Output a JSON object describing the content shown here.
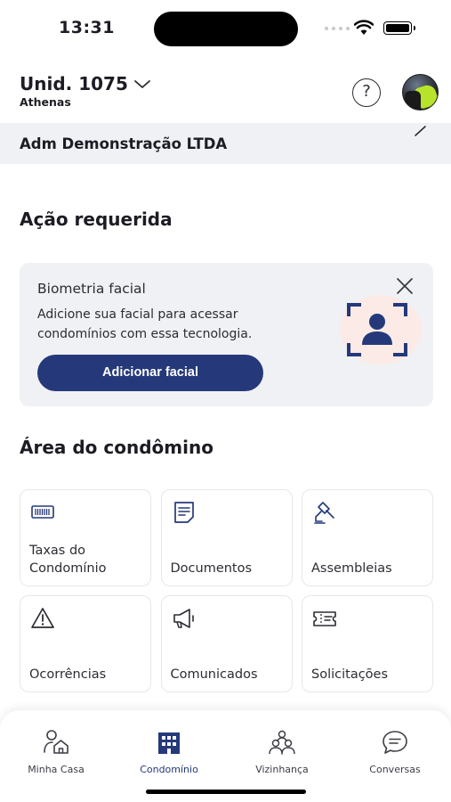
{
  "status_bar": {
    "time": "13:31"
  },
  "header": {
    "unit_title": "Unid. 1075",
    "unit_subtitle": "Athenas",
    "help_label": "?"
  },
  "company": {
    "name": "Adm Demonstração LTDA"
  },
  "action_section": {
    "title": "Ação requerida"
  },
  "biometric_card": {
    "title": "Biometria facial",
    "description": "Adicione sua facial para acessar condomínios com essa tecnologia.",
    "button_label": "Adicionar facial"
  },
  "condo_section": {
    "title": "Área do condômino",
    "tiles": [
      {
        "label": "Taxas do Condomínio",
        "icon": "barcode-icon"
      },
      {
        "label": "Documentos",
        "icon": "document-icon"
      },
      {
        "label": "Assembleias",
        "icon": "gavel-icon"
      },
      {
        "label": "Ocorrências",
        "icon": "warning-icon"
      },
      {
        "label": "Comunicados",
        "icon": "megaphone-icon"
      },
      {
        "label": "Solicitações",
        "icon": "ticket-icon"
      }
    ]
  },
  "bottom_nav": {
    "items": [
      {
        "label": "Minha Casa",
        "icon": "person-home-icon"
      },
      {
        "label": "Condomínio",
        "icon": "building-icon",
        "active": true
      },
      {
        "label": "Vizinhança",
        "icon": "neighbors-icon"
      },
      {
        "label": "Conversas",
        "icon": "chat-icon"
      }
    ]
  },
  "colors": {
    "primary": "#25397a",
    "card_background": "#f0f1f4",
    "text": "#1c1c24"
  }
}
